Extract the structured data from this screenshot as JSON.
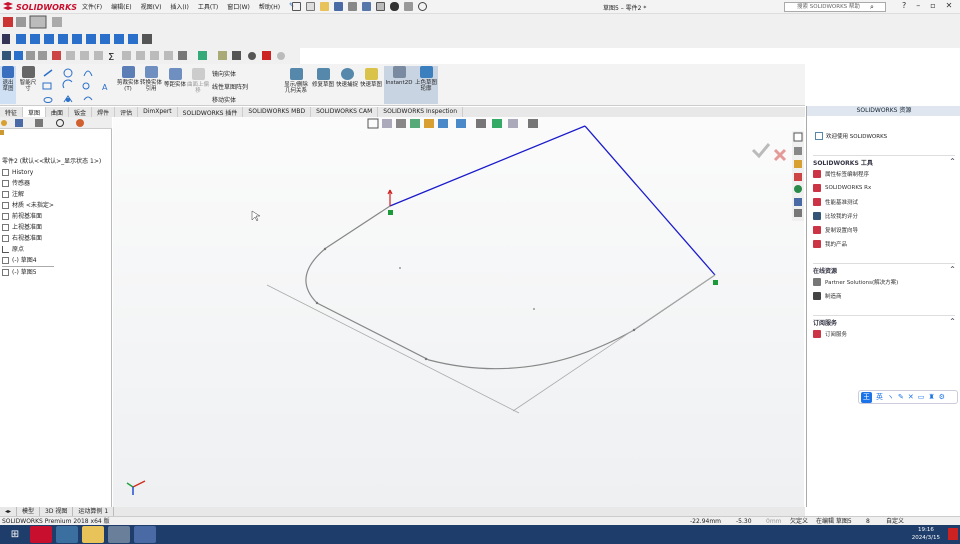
{
  "app": {
    "name": "SOLIDWORKS",
    "doc_title": "草图5 – 零件2 *"
  },
  "menu": [
    "文件(F)",
    "编辑(E)",
    "视图(V)",
    "插入(I)",
    "工具(T)",
    "窗口(W)",
    "帮助(H)"
  ],
  "search": {
    "placeholder": "搜索 SOLIDWORKS 帮助"
  },
  "ribbon": {
    "buttons": [
      "退出草图",
      "智能尺寸",
      "剪裁实体(T)",
      "转换实体引用",
      "等距实体",
      "曲面上偏移",
      "显示/删除几何关系",
      "修复草图",
      "快速捕捉",
      "快速草图",
      "Instant2D",
      "上色草图轮廓"
    ],
    "right_group": [
      "镜向实体",
      "线性草图阵列",
      "移动实体"
    ]
  },
  "tabs": [
    "特征",
    "草图",
    "曲面",
    "钣金",
    "焊件",
    "评估",
    "DimXpert",
    "SOLIDWORKS 插件",
    "SOLIDWORKS MBD",
    "SOLIDWORKS CAM",
    "SOLIDWORKS Inspection"
  ],
  "active_tab": "草图",
  "tree": {
    "root": "零件2 (默认<<默认>_显示状态 1>)",
    "items": [
      "History",
      "传感器",
      "注解",
      "材质 <未指定>",
      "前视基准面",
      "上视基准面",
      "右视基准面",
      "原点",
      "(-) 草图4",
      "(-) 草图5"
    ]
  },
  "right_panel": {
    "title": "SOLIDWORKS 资源",
    "welcome": "欢迎使用 SOLIDWORKS",
    "sections": [
      {
        "title": "SOLIDWORKS 工具",
        "items": [
          "属性标签编制程序",
          "SOLIDWORKS Rx",
          "性能基准测试",
          "比较我的评分",
          "复制设置向导",
          "我的产品"
        ]
      },
      {
        "title": "在线资源",
        "items": [
          "Partner Solutions(解决方案)",
          "制造商"
        ]
      },
      {
        "title": "订阅服务",
        "items": [
          "订阅服务"
        ]
      }
    ]
  },
  "ime": {
    "label": "英"
  },
  "bottom_tabs": [
    "模型",
    "3D 视图",
    "运动算例 1"
  ],
  "status": {
    "product": "SOLIDWORKS Premium 2018 x64 版",
    "x": "-22.94mm",
    "y": "-5.30",
    "z": "0mm",
    "def_state": "欠定义",
    "editing": "在编辑 草图5",
    "units": "自定义"
  },
  "clock": {
    "time": "19:16",
    "date": "2024/3/15"
  }
}
